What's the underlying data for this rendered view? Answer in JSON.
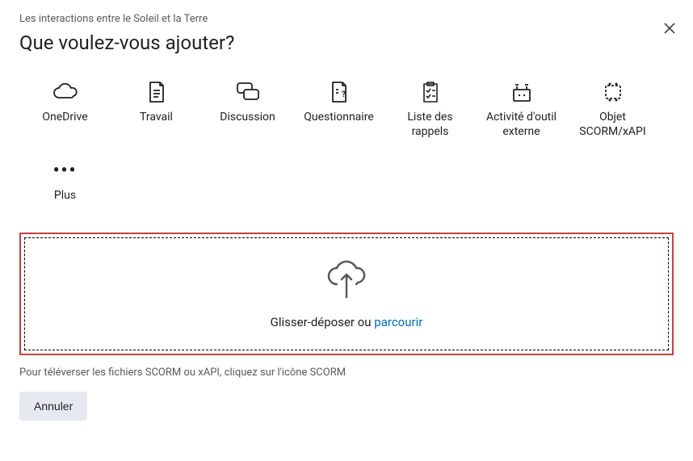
{
  "breadcrumb": "Les interactions entre le Soleil et la Terre",
  "title": "Que voulez-vous ajouter?",
  "tiles": [
    {
      "label": "OneDrive"
    },
    {
      "label": "Travail"
    },
    {
      "label": "Discussion"
    },
    {
      "label": "Questionnaire"
    },
    {
      "label": "Liste des rappels"
    },
    {
      "label": "Activité d'outil externe"
    },
    {
      "label": "Objet SCORM/xAPI"
    },
    {
      "label": "Plus"
    }
  ],
  "dropzone": {
    "prefix": "Glisser-déposer ou ",
    "browse": "parcourir"
  },
  "help_text": "Pour téléverser les fichiers SCORM ou xAPI, cliquez sur l'icône SCORM",
  "cancel_label": "Annuler"
}
